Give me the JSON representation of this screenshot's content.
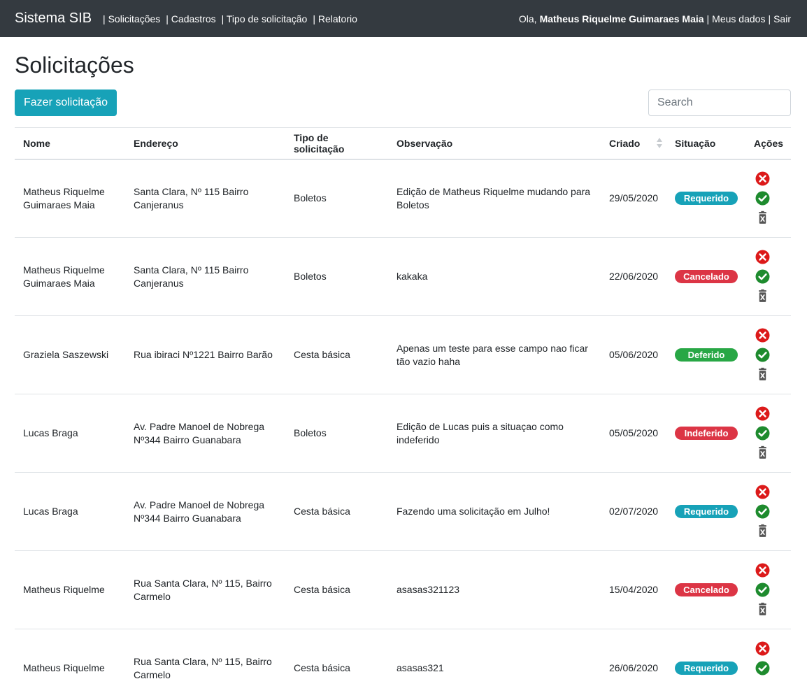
{
  "navbar": {
    "brand": "Sistema SIB",
    "links": [
      "| Solicitações",
      "| Cadastros",
      "| Tipo de solicitação",
      "| Relatorio"
    ],
    "greeting": "Ola,",
    "user": "Matheus Riquelme Guimaraes Maia",
    "my_data": "Meus dados",
    "logout": "Sair",
    "separator": "|"
  },
  "page": {
    "title": "Solicitações",
    "new_request_label": "Fazer solicitação",
    "search_placeholder": "Search"
  },
  "table": {
    "headers": [
      "Nome",
      "Endereço",
      "Tipo de solicitação",
      "Observação",
      "Criado",
      "Situação",
      "Ações"
    ],
    "rows": [
      {
        "nome": "Matheus Riquelme Guimaraes Maia",
        "endereco": "Santa Clara, Nº 115 Bairro Canjeranus",
        "tipo": "Boletos",
        "obs": "Edição de Matheus Riquelme mudando para Boletos",
        "criado": "29/05/2020",
        "situacao": "Requerido",
        "color": "#17a2b8"
      },
      {
        "nome": "Matheus Riquelme Guimaraes Maia",
        "endereco": "Santa Clara, Nº 115 Bairro Canjeranus",
        "tipo": "Boletos",
        "obs": "kakaka",
        "criado": "22/06/2020",
        "situacao": "Cancelado",
        "color": "#dc3545"
      },
      {
        "nome": "Graziela Saszewski",
        "endereco": "Rua ibiraci Nº1221 Bairro Barão",
        "tipo": "Cesta básica",
        "obs": "Apenas um teste para esse campo nao ficar tão vazio haha",
        "criado": "05/06/2020",
        "situacao": "Deferido",
        "color": "#28a745"
      },
      {
        "nome": "Lucas Braga",
        "endereco": "Av. Padre Manoel de Nobrega Nº344 Bairro Guanabara",
        "tipo": "Boletos",
        "obs": "Edição de Lucas puis a situaçao como indeferido",
        "criado": "05/05/2020",
        "situacao": "Indeferido",
        "color": "#dc3545"
      },
      {
        "nome": "Lucas Braga",
        "endereco": "Av. Padre Manoel de Nobrega Nº344 Bairro Guanabara",
        "tipo": "Cesta básica",
        "obs": "Fazendo uma solicitação em Julho!",
        "criado": "02/07/2020",
        "situacao": "Requerido",
        "color": "#17a2b8"
      },
      {
        "nome": "Matheus Riquelme",
        "endereco": "Rua Santa Clara, Nº 115, Bairro Carmelo",
        "tipo": "Cesta básica",
        "obs": "asasas321123",
        "criado": "15/04/2020",
        "situacao": "Cancelado",
        "color": "#dc3545"
      },
      {
        "nome": "Matheus Riquelme",
        "endereco": "Rua Santa Clara, Nº 115, Bairro Carmelo",
        "tipo": "Cesta básica",
        "obs": "asasas321",
        "criado": "26/06/2020",
        "situacao": "Requerido",
        "color": "#17a2b8"
      }
    ]
  },
  "icons": {
    "reject": "x-circle-icon",
    "approve": "check-circle-icon",
    "delete": "trash-icon"
  },
  "colors": {
    "navbar_bg": "#343a40",
    "primary": "#17a2b8",
    "danger": "#dc3545",
    "success": "#28a745",
    "reject_icon": "#dc1a1a",
    "approve_icon": "#1e8b2e",
    "trash_icon": "#555555"
  }
}
